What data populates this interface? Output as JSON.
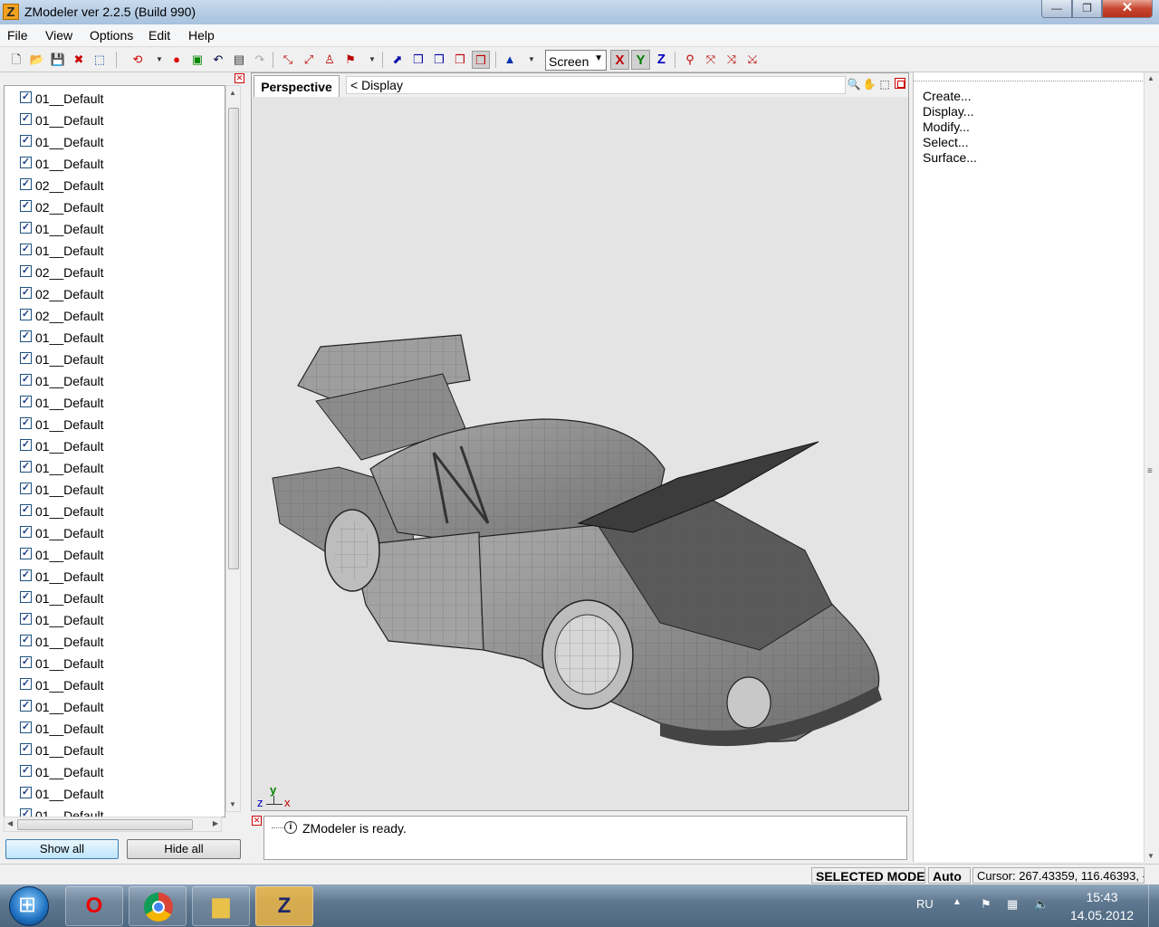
{
  "window": {
    "title": "ZModeler ver 2.2.5 (Build 990)",
    "app_icon_letter": "Z",
    "min_glyph": "—",
    "max_glyph": "❐",
    "close_glyph": "✕"
  },
  "menu": [
    "File",
    "View",
    "Options",
    "Edit",
    "Help"
  ],
  "toolbar": {
    "icons_group1": [
      "new-icon",
      "open-icon",
      "save-icon",
      "delete-icon",
      "import-icon",
      "undo-history-icon",
      "record-icon",
      "export-icon",
      "undo-icon",
      "properties-icon",
      "redo-icon"
    ],
    "icons_group2": [
      "select-vertex-icon",
      "select-edge-icon",
      "select-object-icon",
      "select-group-icon"
    ],
    "icons_group3": [
      "box-1-icon",
      "box-2-icon",
      "box-3-icon",
      "box-4-icon",
      "box-5-icon"
    ],
    "coord_mode": "Screen",
    "axes": [
      "X",
      "Y",
      "Z"
    ],
    "axis_colors": [
      "#c00000",
      "#008000",
      "#0000c0"
    ]
  },
  "materials": {
    "items": [
      "01__Default",
      "01__Default",
      "01__Default",
      "01__Default",
      "02__Default",
      "02__Default",
      "01__Default",
      "01__Default",
      "02__Default",
      "02__Default",
      "02__Default",
      "01__Default",
      "01__Default",
      "01__Default",
      "01__Default",
      "01__Default",
      "01__Default",
      "01__Default",
      "01__Default",
      "01__Default",
      "01__Default",
      "01__Default",
      "01__Default",
      "01__Default",
      "01__Default",
      "01__Default",
      "01__Default",
      "01__Default",
      "01__Default",
      "01__Default",
      "01__Default",
      "01__Default",
      "01__Default",
      "01__Default"
    ],
    "checked_glyph": "✓",
    "show_all_label": "Show all",
    "hide_all_label": "Hide all"
  },
  "viewport": {
    "tab_label": "Perspective",
    "display_label": "<  Display",
    "axis_labels": {
      "y": "y",
      "z": "z",
      "x": "x"
    }
  },
  "commands": [
    "Create...",
    "Display...",
    "Modify...",
    "Select...",
    "Surface..."
  ],
  "log": {
    "message": "ZModeler is ready.",
    "icon_glyph": "i"
  },
  "status": {
    "mode": "SELECTED MODE",
    "auto": "Auto",
    "cursor": "Cursor: 267.43359, 116.46393, -"
  },
  "taskbar": {
    "apps": [
      "opera-icon",
      "chrome-icon",
      "explorer-icon",
      "zmodeler-icon"
    ],
    "opera_glyph": "O",
    "zmodeler_glyph": "Z",
    "lang": "RU",
    "time": "15:43",
    "date": "14.05.2012"
  }
}
